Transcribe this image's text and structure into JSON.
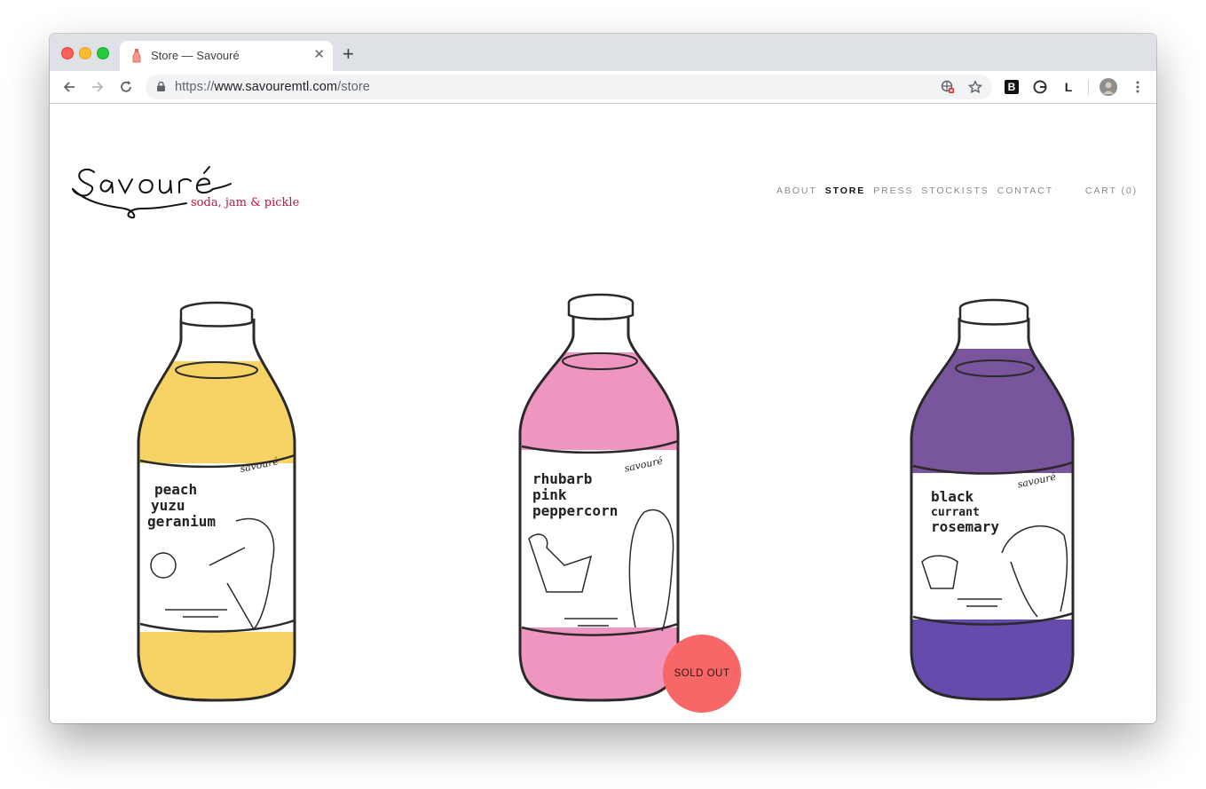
{
  "browser": {
    "tab_title": "Store — Savouré",
    "new_tab_symbol": "+",
    "close_symbol": "✕",
    "url_scheme": "https://",
    "url_host": "www.savouremtl.com",
    "url_path": "/store",
    "extensions": [
      "B",
      "G",
      "L"
    ]
  },
  "site": {
    "logo_text": "savouré",
    "tagline": "soda, jam & pickle",
    "nav": [
      {
        "label": "ABOUT"
      },
      {
        "label": "STORE",
        "active": true
      },
      {
        "label": "PRESS"
      },
      {
        "label": "STOCKISTS"
      },
      {
        "label": "CONTACT"
      }
    ],
    "cart_label": "CART (0)"
  },
  "products": [
    {
      "label_lines": [
        "peach",
        "yuzu",
        "geranium"
      ],
      "brand": "savouré",
      "liquid_color": "#f5c842",
      "sold_out": false
    },
    {
      "label_lines": [
        "rhubarb",
        "pink",
        "peppercorn"
      ],
      "brand": "savouré",
      "liquid_color": "#ec7fb2",
      "sold_out": true
    },
    {
      "label_lines": [
        "black",
        "currant",
        "rosemary"
      ],
      "brand": "savouré",
      "liquid_color": "#5a2f86",
      "sold_out": false
    }
  ],
  "badges": {
    "sold_out": "SOLD OUT"
  },
  "colors": {
    "accent": "#c4123e",
    "sold_badge": "#f76767"
  }
}
